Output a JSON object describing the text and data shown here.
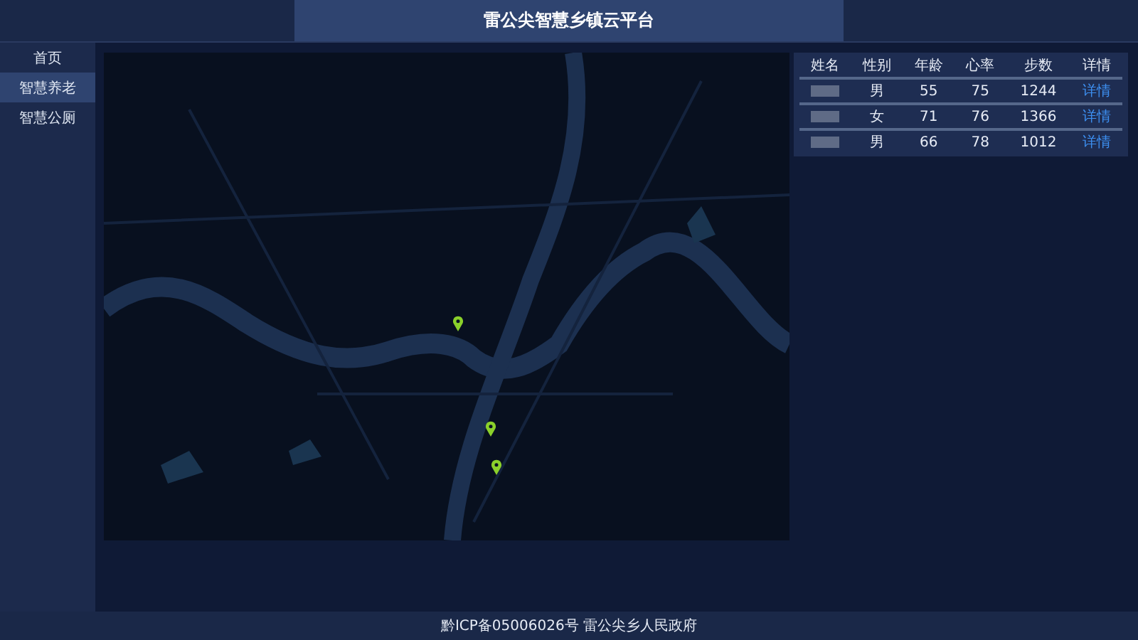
{
  "header": {
    "title": "雷公尖智慧乡镇云平台"
  },
  "sidebar": {
    "items": [
      {
        "label": "首页",
        "selected": false
      },
      {
        "label": "智慧养老",
        "selected": true
      },
      {
        "label": "智慧公厕",
        "selected": false
      }
    ]
  },
  "table": {
    "columns": [
      "姓名",
      "性别",
      "年龄",
      "心率",
      "步数",
      "详情"
    ],
    "rows": [
      {
        "gender": "男",
        "age": "55",
        "heart_rate": "75",
        "steps": "1244",
        "details": "详情"
      },
      {
        "gender": "女",
        "age": "71",
        "heart_rate": "76",
        "steps": "1366",
        "details": "详情"
      },
      {
        "gender": "男",
        "age": "66",
        "heart_rate": "78",
        "steps": "1012",
        "details": "详情"
      }
    ]
  },
  "footer": {
    "text": "黔ICP备05006026号 雷公尖乡人民政府"
  }
}
